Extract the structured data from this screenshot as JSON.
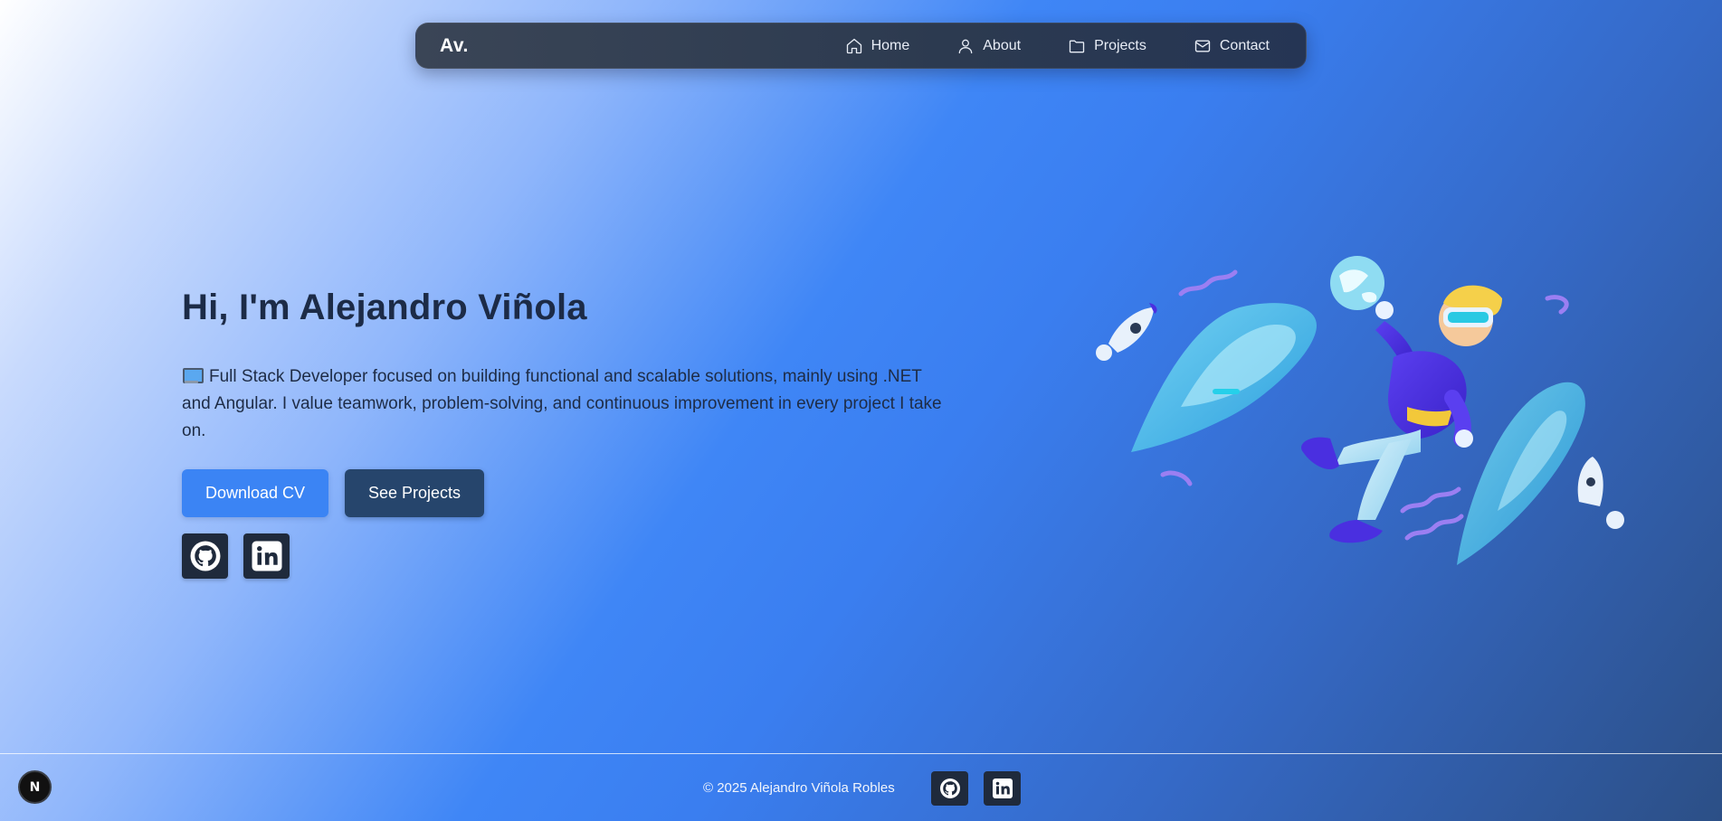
{
  "nav": {
    "brand": "Av.",
    "items": [
      {
        "label": "Home",
        "icon": "home-icon"
      },
      {
        "label": "About",
        "icon": "user-icon"
      },
      {
        "label": "Projects",
        "icon": "folder-icon"
      },
      {
        "label": "Contact",
        "icon": "mail-icon"
      }
    ]
  },
  "hero": {
    "title": "Hi, I'm Alejandro Viñola",
    "emoji": "laptop-emoji",
    "description": "Full Stack Developer focused on building functional and scalable solutions, mainly using .NET and Angular. I value teamwork, problem-solving, and continuous improvement in every project I take on.",
    "download_cv_label": "Download CV",
    "see_projects_label": "See Projects",
    "social": [
      "github-icon",
      "linkedin-icon"
    ]
  },
  "footer": {
    "copyright": "© 2025 Alejandro Viñola Robles",
    "social": [
      "github-icon",
      "linkedin-icon"
    ]
  },
  "dev_badge": {
    "label": "N"
  },
  "colors": {
    "accent": "#3b84f4",
    "secondary_button": "#26456c",
    "navbar": "#2c3a50",
    "title_text": "#1c2b47",
    "social_bg": "#1f2a3c"
  }
}
